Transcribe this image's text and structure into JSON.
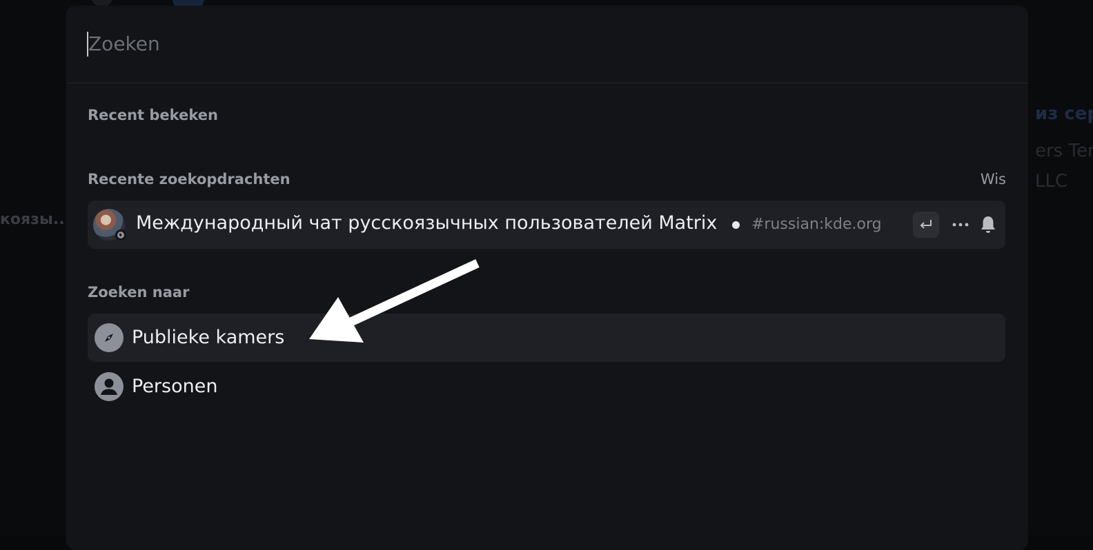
{
  "background": {
    "left_text": "коязы...",
    "right_title": "из сер",
    "right_sub1": "ers Ter",
    "right_sub2": "LLC"
  },
  "search": {
    "placeholder": "Zoeken",
    "value": ""
  },
  "sections": {
    "recently_viewed": "Recent bekeken",
    "recent_searches": "Recente zoekopdrachten",
    "clear_label": "Wis",
    "search_for": "Zoeken naar"
  },
  "recent_searches": [
    {
      "name": "Международный чат русскоязычных пользователей Matrix",
      "alias": "#russian:kde.org",
      "icons": [
        "enter-icon",
        "more-icon",
        "bell-icon"
      ]
    }
  ],
  "search_for_items": [
    {
      "label": "Publieke kamers",
      "icon": "compass-icon",
      "highlighted": true
    },
    {
      "label": "Personen",
      "icon": "person-icon",
      "highlighted": false
    }
  ],
  "colors": {
    "modal_bg": "#131418",
    "item_bg": "#1f2025",
    "label_gray": "#989ba3",
    "text": "#eceef1",
    "annotation_arrow": "#ffffff"
  }
}
